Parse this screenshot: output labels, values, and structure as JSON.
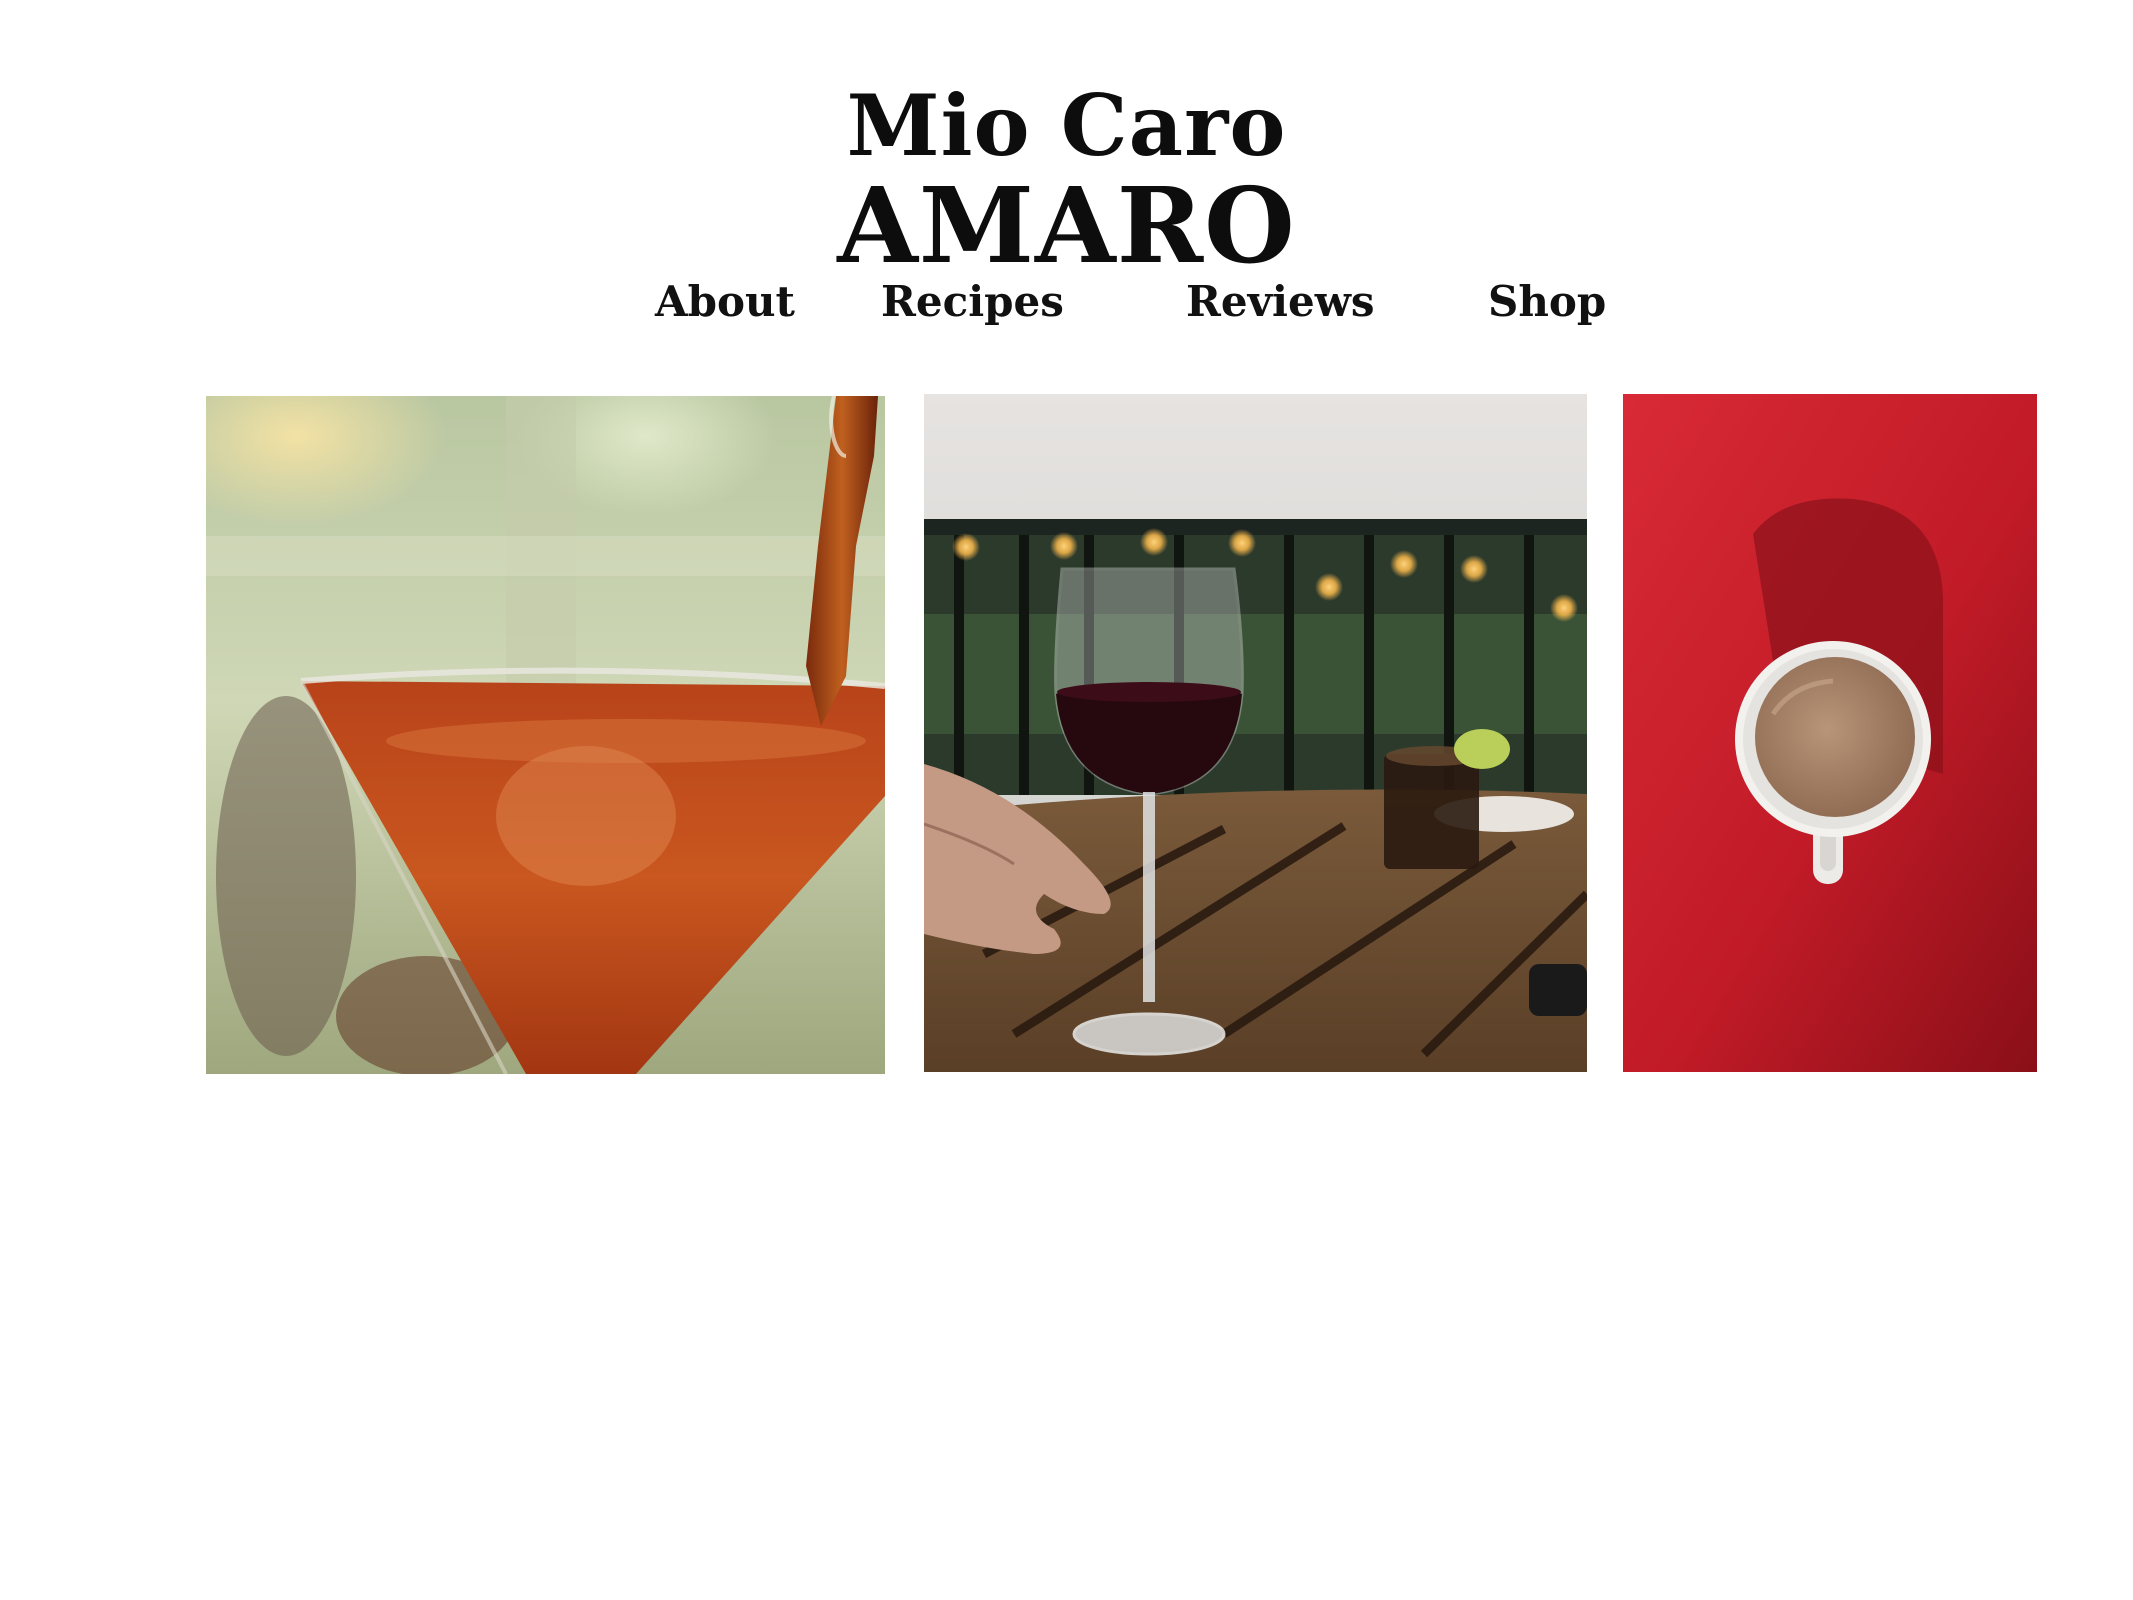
{
  "brand": {
    "line1": "Mio Caro",
    "line2": "AMARO"
  },
  "nav": {
    "items": [
      {
        "label": "About"
      },
      {
        "label": "Recipes"
      },
      {
        "label": "Reviews"
      },
      {
        "label": "Shop"
      }
    ]
  },
  "gallery": {
    "photos": [
      {
        "subject": "cocktail-pour-photo"
      },
      {
        "subject": "red-wine-glass-photo"
      },
      {
        "subject": "coffee-cup-on-red-photo"
      }
    ]
  },
  "colors": {
    "text": "#0d0d0d",
    "background": "#ffffff",
    "accent_red": "#c41e2a"
  }
}
